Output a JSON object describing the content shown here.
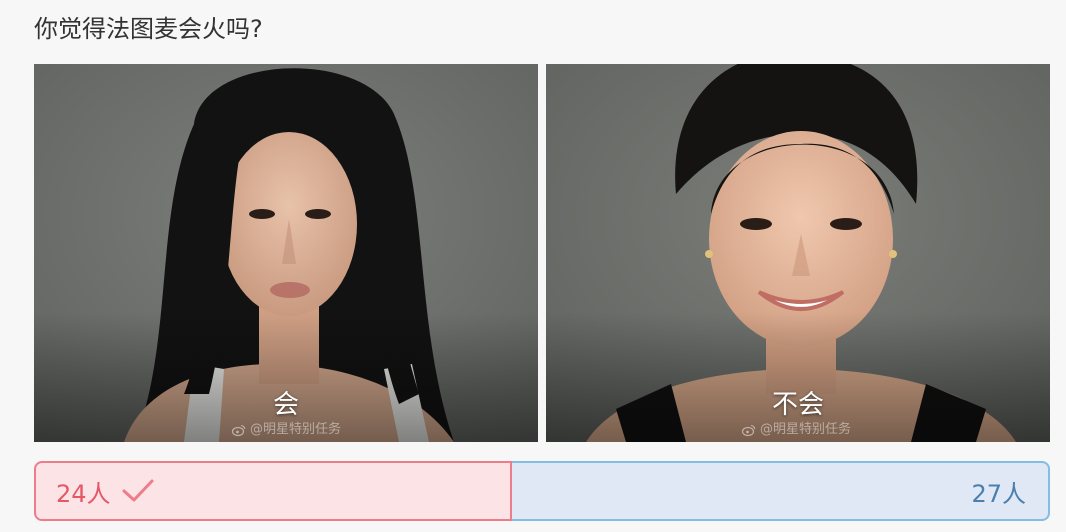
{
  "poll": {
    "question": "你觉得法图麦会火吗?",
    "options": [
      {
        "label": "会",
        "count_text": "24人",
        "votes": 24,
        "selected": true,
        "image_icon": "portrait-photo-long-hair",
        "watermark": "@明星特别任务"
      },
      {
        "label": "不会",
        "count_text": "27人",
        "votes": 27,
        "selected": false,
        "image_icon": "portrait-photo-smiling",
        "watermark": "@明星特别任务"
      }
    ]
  },
  "colors": {
    "yes_fill": "#fce3e6",
    "yes_border": "#ee7c8a",
    "yes_text": "#e45868",
    "no_fill": "#dfe8f4",
    "no_border": "#82bde3",
    "no_text": "#4a7fae"
  },
  "icons": {
    "selected_mark": "checkmark-icon",
    "watermark_logo": "weibo-icon"
  }
}
